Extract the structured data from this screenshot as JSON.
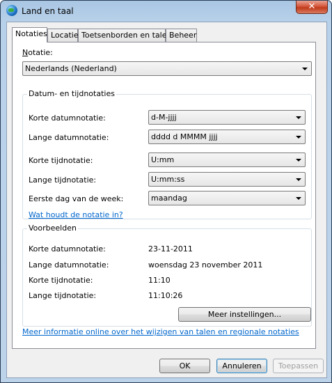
{
  "window": {
    "title": "Land en taal",
    "close_glyph": "✕"
  },
  "tabs": [
    {
      "label": "Notaties",
      "active": true
    },
    {
      "label": "Locatie"
    },
    {
      "label": "Toetsenborden en talen"
    },
    {
      "label": "Beheer"
    }
  ],
  "notatie": {
    "label": "Notatie:",
    "value": "Nederlands (Nederland)"
  },
  "formats": {
    "title": "Datum- en tijdnotaties",
    "rows": [
      {
        "label": "Korte datumnotatie:",
        "value": "d-M-jjjj"
      },
      {
        "label": "Lange datumnotatie:",
        "value": "dddd d MMMM jjjj"
      },
      {
        "label": "Korte tijdnotatie:",
        "value": "U:mm"
      },
      {
        "label": "Lange tijdnotatie:",
        "value": "U:mm:ss"
      },
      {
        "label": "Eerste dag van de week:",
        "value": "maandag"
      }
    ],
    "help_link": "Wat houdt de notatie in?"
  },
  "examples": {
    "title": "Voorbeelden",
    "rows": [
      {
        "label": "Korte datumnotatie:",
        "value": "23-11-2011"
      },
      {
        "label": "Lange datumnotatie:",
        "value": "woensdag 23 november 2011"
      },
      {
        "label": "Korte tijdnotatie:",
        "value": "11:10"
      },
      {
        "label": "Lange tijdnotatie:",
        "value": "11:10:26"
      }
    ]
  },
  "more_settings_button": "Meer instellingen...",
  "info_link": "Meer informatie online over het wijzigen van talen en regionale notaties",
  "buttons": {
    "ok": "OK",
    "cancel": "Annuleren",
    "apply": "Toepassen"
  }
}
